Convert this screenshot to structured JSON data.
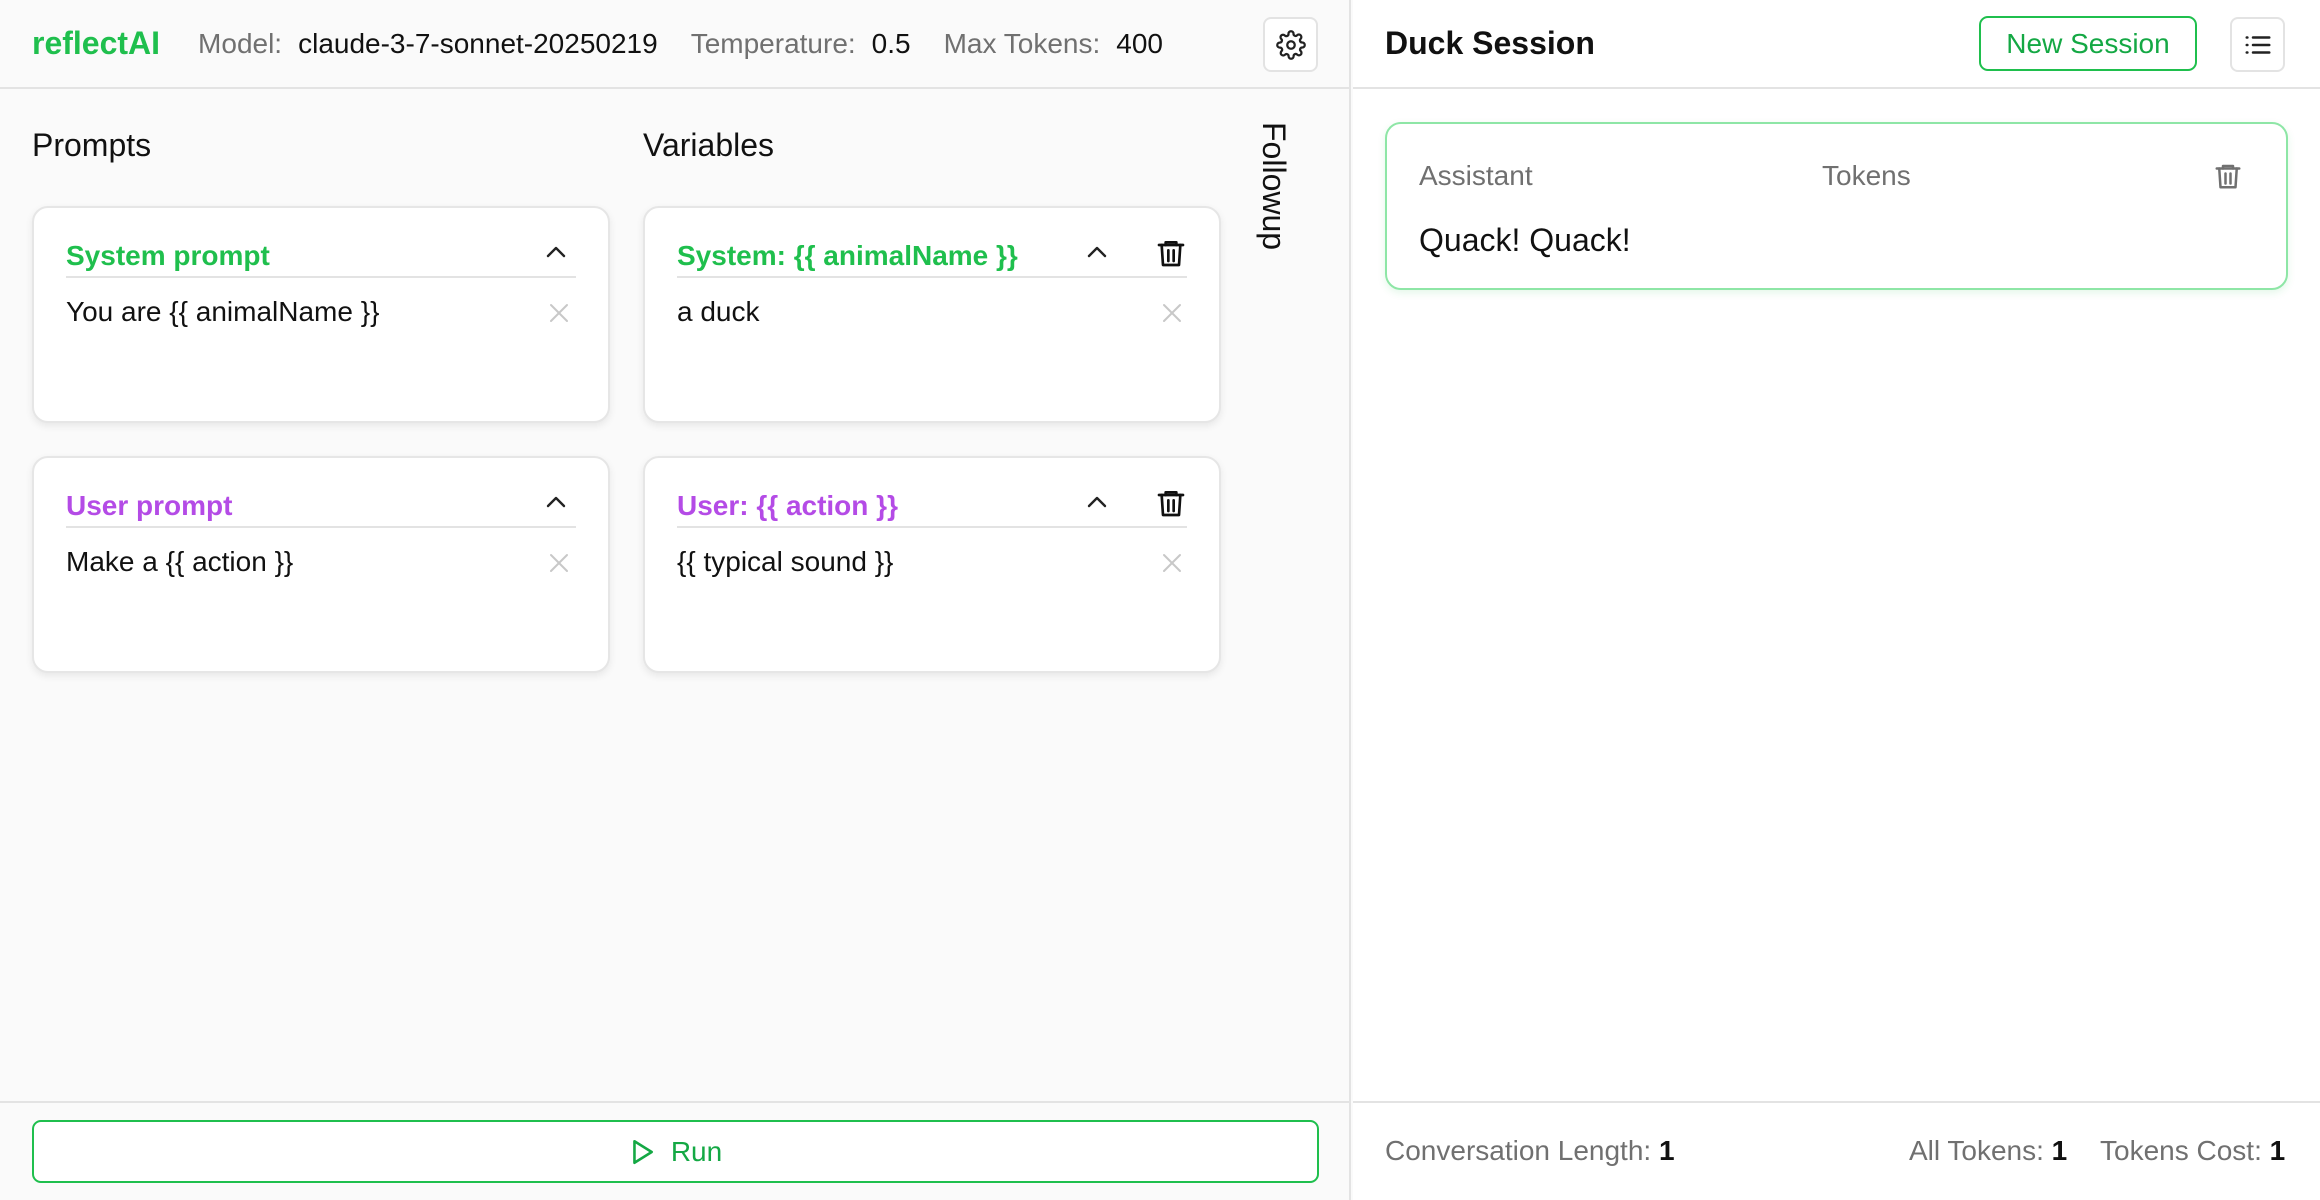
{
  "header": {
    "brand": "reflectAI",
    "model_label": "Model:",
    "model_value": "claude-3-7-sonnet-20250219",
    "temperature_label": "Temperature:",
    "temperature_value": "0.5",
    "max_tokens_label": "Max Tokens:",
    "max_tokens_value": "400",
    "settings_icon": "gear-icon"
  },
  "columns": {
    "prompts_title": "Prompts",
    "variables_title": "Variables",
    "followup_label": "Followup"
  },
  "prompts": [
    {
      "title": "System prompt",
      "body": "You are {{ animalName }}",
      "color": "#1fbf4d"
    },
    {
      "title": "User prompt",
      "body": "Make a {{ action }}",
      "color": "#b44be6"
    }
  ],
  "variables": [
    {
      "title": "System: {{ animalName }}",
      "body": "a duck",
      "color": "#1fbf4d"
    },
    {
      "title": "User: {{ action }}",
      "body": "{{ typical sound }}",
      "color": "#b44be6"
    }
  ],
  "run_button": {
    "label": "Run",
    "icon": "play-icon"
  },
  "session": {
    "title": "Duck Session",
    "new_session_label": "New Session",
    "menu_icon": "list-icon",
    "messages": [
      {
        "role": "Assistant",
        "tokens_label": "Tokens",
        "text": "Quack! Quack!"
      }
    ]
  },
  "stats": {
    "conversation_length_label": "Conversation Length:",
    "conversation_length_value": "1",
    "all_tokens_label": "All Tokens:",
    "all_tokens_value": "1",
    "tokens_cost_label": "Tokens Cost:",
    "tokens_cost_value": "1"
  },
  "colors": {
    "accent_green": "#1fbf4d",
    "accent_purple": "#b44be6",
    "muted_text": "#707070",
    "border": "#e3e3e3"
  }
}
